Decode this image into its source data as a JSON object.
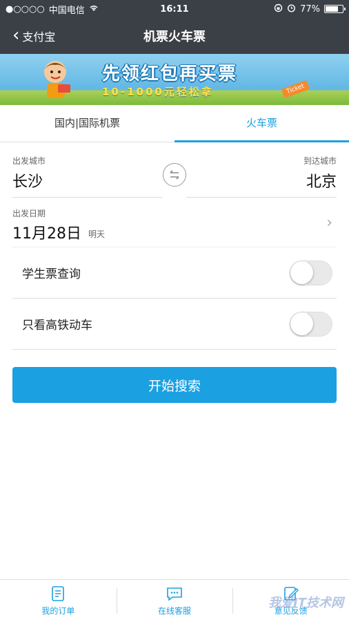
{
  "status_bar": {
    "carrier": "中国电信",
    "signal": "●○○○○",
    "time": "16:11",
    "battery_percent": "77%",
    "battery_level": 0.77
  },
  "nav": {
    "back_label": "支付宝",
    "title": "机票火车票"
  },
  "banner": {
    "headline": "先领红包再买票",
    "sub": "10-1000元轻松拿",
    "ticket_label": "Ticket"
  },
  "tabs": [
    {
      "label": "国内|国际机票",
      "active": false
    },
    {
      "label": "火车票",
      "active": true
    }
  ],
  "route": {
    "from_label": "出发城市",
    "from_city": "长沙",
    "to_label": "到达城市",
    "to_city": "北京"
  },
  "date": {
    "label": "出发日期",
    "value": "11月28日",
    "hint": "明天"
  },
  "options": [
    {
      "label": "学生票查询",
      "on": false
    },
    {
      "label": "只看高铁动车",
      "on": false
    }
  ],
  "search_button": "开始搜索",
  "bottom_bar": [
    {
      "label": "我的订单",
      "icon": "order-icon"
    },
    {
      "label": "在线客服",
      "icon": "chat-icon"
    },
    {
      "label": "意见反馈",
      "icon": "feedback-icon"
    }
  ],
  "watermark": "我爱IT技术网",
  "colors": {
    "accent": "#1ba0e2",
    "nav_bg": "#3b3f46"
  }
}
